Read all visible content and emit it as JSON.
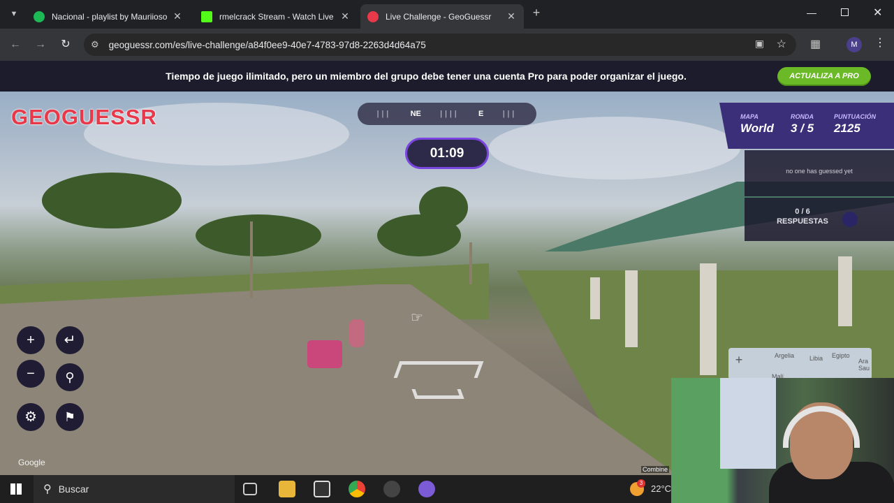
{
  "browser": {
    "tabs": [
      {
        "title": "Nacional - playlist by Mauriioso",
        "favicon_color": "#1db954"
      },
      {
        "title": "rmelcrack Stream - Watch Live o",
        "favicon_color": "#53fc18"
      },
      {
        "title": "Live Challenge - GeoGuessr",
        "favicon_color": "#e8394a"
      }
    ],
    "url": "geoguessr.com/es/live-challenge/a84f0ee9-40e7-4783-97d8-2263d4d64a75",
    "profile_initial": "M"
  },
  "banner": {
    "message": "Tiempo de juego ilimitado, pero un miembro del grupo debe tener una cuenta Pro para poder organizar el juego.",
    "pro_button": "ACTUALIZA A PRO"
  },
  "game": {
    "logo": "GEOGUESSR",
    "compass": {
      "ne": "NE",
      "e": "E"
    },
    "timer": "01:09",
    "status": {
      "map_label": "MAPA",
      "map_value": "World",
      "round_label": "RONDA",
      "round_value": "3 / 5",
      "score_label": "PUNTUACIÓN",
      "score_value": "2125"
    },
    "guess_status": "no one has guessed yet",
    "answers_count": "0 / 6",
    "answers_label": "RESPUESTAS",
    "minimap_labels": [
      "Argelia",
      "Libia",
      "Egipto",
      "Ara Sau",
      "Malí"
    ],
    "google_credit": "Google",
    "combine_text": "Combine"
  },
  "taskbar": {
    "search_placeholder": "Buscar",
    "weather": "22°C",
    "weather_badge": "3"
  },
  "colors": {
    "brand": "#e8394a",
    "pro_green": "#6cb928",
    "timer_border": "#7b46e0",
    "panel": "#3a2f78"
  }
}
